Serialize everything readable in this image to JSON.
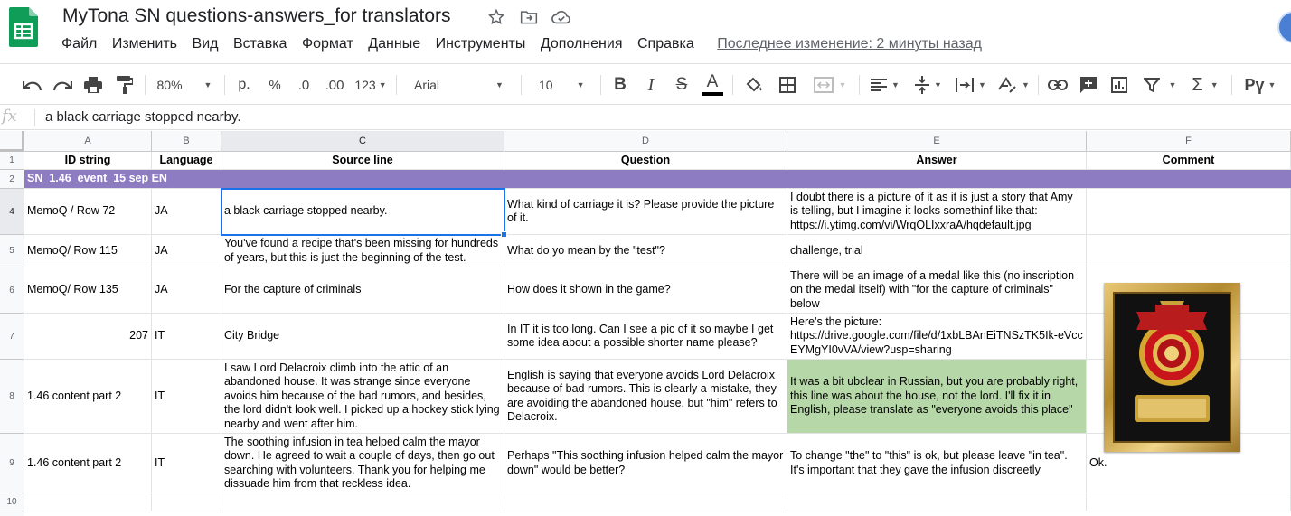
{
  "app": {
    "doc_title": "MyTona SN questions-answers_for translators",
    "colors": {
      "accent": "#1a73e8",
      "purple_row": "#8e7cc3",
      "green_cell": "#b6d7a8",
      "logo_green": "#0f9d58"
    }
  },
  "menu": {
    "items": [
      "Файл",
      "Изменить",
      "Вид",
      "Вставка",
      "Формат",
      "Данные",
      "Инструменты",
      "Дополнения",
      "Справка"
    ],
    "last_edit": "Последнее изменение: 2 минуты назад"
  },
  "toolbar": {
    "zoom": "80%",
    "currency": "р.",
    "percent": "%",
    "decrease_decimal": ".0",
    "increase_decimal": ".00",
    "more_formats": "123",
    "font": "Arial",
    "font_size": "10",
    "input_tools": "Рү"
  },
  "formula_bar": {
    "fx": "fx",
    "value": "a black carriage stopped nearby."
  },
  "grid": {
    "columns": [
      "A",
      "B",
      "C",
      "D",
      "E",
      "F"
    ],
    "rows": [
      "1",
      "2",
      "4",
      "5",
      "6",
      "7",
      "8",
      "9",
      "10"
    ],
    "header": {
      "a": "ID string",
      "b": "Language",
      "c": "Source line",
      "d": "Question",
      "e": "Answer",
      "f": "Comment"
    },
    "section": "SN_1.46_event_15 sep EN",
    "r4": {
      "a": "MemoQ / Row 72",
      "b": "JA",
      "c": "a black carriage stopped nearby.",
      "d": [
        "What kind of carriage it is? Please provide the picture",
        "of it."
      ],
      "e": [
        "I doubt there is a picture of it as it is just a story that Amy",
        "is telling, but I imagine it looks somethinf like that:",
        "https://i.ytimg.com/vi/WrqOLIxxraA/hqdefault.jpg"
      ]
    },
    "r5": {
      "a": "MemoQ/ Row 115",
      "b": "JA",
      "c": [
        "You've found a recipe that's been missing for hundreds",
        "of years, but this is just the beginning of the test."
      ],
      "d": "What do yo mean by the \"test\"?",
      "e": "challenge, trial"
    },
    "r6": {
      "a": "MemoQ/ Row 135",
      "b": "JA",
      "c": "For the capture of criminals",
      "d": "How does it shown in the game?",
      "e": [
        "There will be an image of a medal like this (no inscription",
        "on the medal itself) with \"for the capture of criminals\"",
        "below"
      ]
    },
    "r7": {
      "a": "207",
      "b": "IT",
      "c": "City Bridge",
      "d": [
        "In IT it is too long. Can I see a pic of it so maybe I get",
        "some idea about a possible shorter name please?"
      ],
      "e": [
        "Here's the picture:",
        "https://drive.google.com/file/d/1xbLBAnEiTNSzTK5Ik-eVcc",
        "EYMgYI0vVA/view?usp=sharing"
      ]
    },
    "r8": {
      "a": "1.46 content part 2",
      "b": "IT",
      "c": [
        "I saw Lord Delacroix climb into the attic of an",
        "abandoned house. It was strange since everyone",
        "avoids him because of the bad rumors, and besides,",
        "the lord didn't look well. I picked up a hockey stick lying",
        "nearby and went after him."
      ],
      "d": [
        "English is saying that everyone avoids Lord Delacroix",
        "because of bad rumors. This is clearly a mistake, they",
        "are avoiding the abandoned house, but \"him\" refers to",
        "Delacroix."
      ],
      "e": [
        "It was a bit ubclear in Russian, but you are probably right,",
        "this line was about the house, not the lord. I'll fix it in",
        "English, please translate as \"everyone avoids this place\""
      ]
    },
    "r9": {
      "a": "1.46 content part 2",
      "b": "IT",
      "c": [
        "The soothing infusion in tea helped calm the mayor",
        "down. He agreed to wait a couple of days, then go out",
        "searching with volunteers. Thank you for helping me",
        "dissuade him from that reckless idea."
      ],
      "d": [
        "Perhaps \"This soothing infusion helped calm the mayor",
        "down\" would be better?"
      ],
      "e": [
        "To change \"the\" to \"this\" is ok, but please leave \"in tea\".",
        "It's important that they gave the infusion discreetly"
      ],
      "f": "Ok."
    }
  }
}
